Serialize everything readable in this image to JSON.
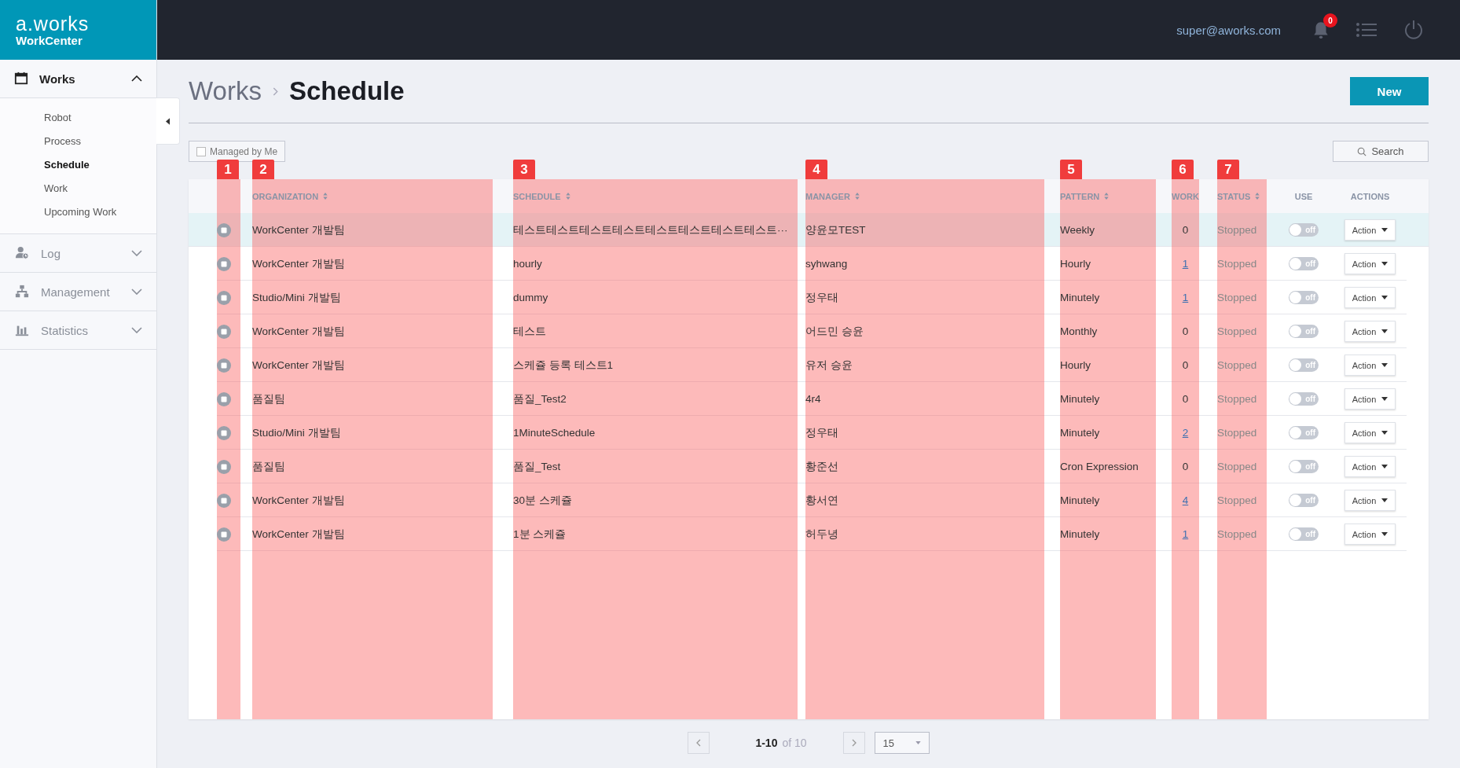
{
  "sidebar": {
    "logo": "a.works",
    "product": "WorkCenter",
    "items": [
      {
        "label": "Works",
        "expanded": true,
        "children": [
          {
            "label": "Robot",
            "selected": false
          },
          {
            "label": "Process",
            "selected": false
          },
          {
            "label": "Schedule",
            "selected": true
          },
          {
            "label": "Work",
            "selected": false
          },
          {
            "label": "Upcoming Work",
            "selected": false
          }
        ]
      },
      {
        "label": "Log",
        "expanded": false
      },
      {
        "label": "Management",
        "expanded": false
      },
      {
        "label": "Statistics",
        "expanded": false
      }
    ]
  },
  "topbar": {
    "user": "super@aworks.com",
    "notification_count": "0"
  },
  "breadcrumb": [
    {
      "label": "Works",
      "selected": false
    },
    {
      "label": "Schedule",
      "selected": true
    }
  ],
  "new_button": "New",
  "filter": {
    "label": "Managed by Me",
    "checked": false
  },
  "search_button": "Search",
  "table": {
    "columns": [
      {
        "annotation": "1"
      },
      {
        "label": "ORGANIZATION",
        "sortable": true,
        "annotation": "2"
      },
      {
        "label": "SCHEDULE",
        "sortable": true,
        "annotation": "3"
      },
      {
        "label": "MANAGER",
        "sortable": true,
        "annotation": "4"
      },
      {
        "label": "PATTERN",
        "sortable": true,
        "annotation": "5"
      },
      {
        "label": "WORK",
        "sortable": false,
        "annotation": "6"
      },
      {
        "label": "STATUS",
        "sortable": true,
        "annotation": "7"
      },
      {
        "label": "USE",
        "sortable": false
      },
      {
        "label": "ACTIONS",
        "sortable": false
      }
    ],
    "rows": [
      {
        "selected": true,
        "organization": "WorkCenter 개발팀",
        "schedule": "테스트테스트테스트테스트테스트테스트테스트테스트···",
        "manager": "양윤모TEST",
        "pattern": "Weekly",
        "work": "0",
        "work_link": false,
        "status": "Stopped",
        "use": {
          "on": false,
          "label": "off"
        },
        "action": "Action"
      },
      {
        "selected": false,
        "organization": "WorkCenter 개발팀",
        "schedule": "hourly",
        "manager": "syhwang",
        "pattern": "Hourly",
        "work": "1",
        "work_link": true,
        "status": "Stopped",
        "use": {
          "on": false,
          "label": "off"
        },
        "action": "Action"
      },
      {
        "selected": false,
        "organization": "Studio/Mini 개발팀",
        "schedule": "dummy",
        "manager": "정우태",
        "pattern": "Minutely",
        "work": "1",
        "work_link": true,
        "status": "Stopped",
        "use": {
          "on": false,
          "label": "off"
        },
        "action": "Action"
      },
      {
        "selected": false,
        "organization": "WorkCenter 개발팀",
        "schedule": "테스트",
        "manager": "어드민 승윤",
        "pattern": "Monthly",
        "work": "0",
        "work_link": false,
        "status": "Stopped",
        "use": {
          "on": false,
          "label": "off"
        },
        "action": "Action"
      },
      {
        "selected": false,
        "organization": "WorkCenter 개발팀",
        "schedule": "스케쥴 등록 테스트1",
        "manager": "유저 승윤",
        "pattern": "Hourly",
        "work": "0",
        "work_link": false,
        "status": "Stopped",
        "use": {
          "on": false,
          "label": "off"
        },
        "action": "Action"
      },
      {
        "selected": false,
        "organization": "품질팀",
        "schedule": "품질_Test2",
        "manager": "4r4",
        "pattern": "Minutely",
        "work": "0",
        "work_link": false,
        "status": "Stopped",
        "use": {
          "on": false,
          "label": "off"
        },
        "action": "Action"
      },
      {
        "selected": false,
        "organization": "Studio/Mini 개발팀",
        "schedule": "1MinuteSchedule",
        "manager": "정우태",
        "pattern": "Minutely",
        "work": "2",
        "work_link": true,
        "status": "Stopped",
        "use": {
          "on": false,
          "label": "off"
        },
        "action": "Action"
      },
      {
        "selected": false,
        "organization": "품질팀",
        "schedule": "품질_Test",
        "manager": "황준선",
        "pattern": "Cron Expression",
        "work": "0",
        "work_link": false,
        "status": "Stopped",
        "use": {
          "on": false,
          "label": "off"
        },
        "action": "Action"
      },
      {
        "selected": false,
        "organization": "WorkCenter 개발팀",
        "schedule": "30분 스케쥴",
        "manager": "황서연",
        "pattern": "Minutely",
        "work": "4",
        "work_link": true,
        "status": "Stopped",
        "use": {
          "on": false,
          "label": "off"
        },
        "action": "Action"
      },
      {
        "selected": false,
        "organization": "WorkCenter 개발팀",
        "schedule": "1분 스케쥴",
        "manager": "허두녕",
        "pattern": "Minutely",
        "work": "1",
        "work_link": true,
        "status": "Stopped",
        "use": {
          "on": false,
          "label": "off"
        },
        "action": "Action"
      }
    ]
  },
  "pagination": {
    "range": "1-10",
    "total": "of 10",
    "page_size": "15"
  }
}
